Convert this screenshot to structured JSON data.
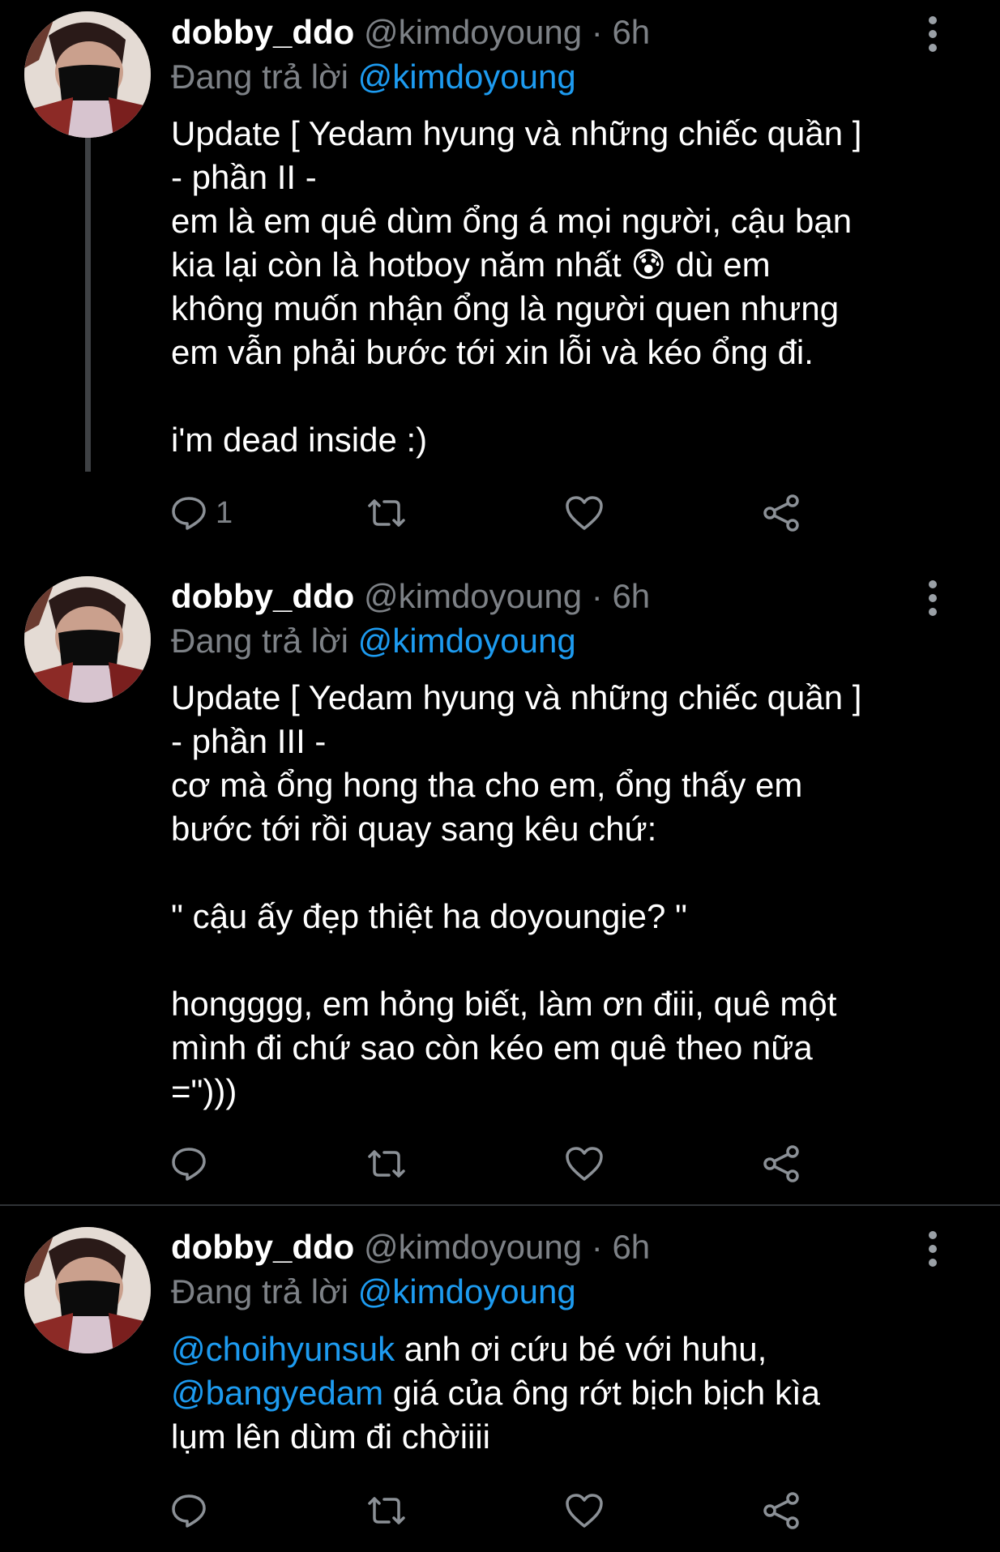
{
  "tweets": [
    {
      "display_name": "dobby_ddo",
      "handle": "@kimdoyoung",
      "separator": "·",
      "time": "6h",
      "reply_prefix": "Đang trả lời",
      "reply_to": "@kimdoyoung",
      "lines": [
        "Update [ Yedam hyung và những chiếc quần ]",
        "- phần II -",
        "em là em quê dùm ổng á mọi người, cậu bạn",
        "kia lại còn là hotboy năm nhất",
        "không muốn nhận ổng là người quen nhưng",
        "em vẫn phải bước tới xin lỗi và kéo ổng đi.",
        "",
        "i'm dead inside :)"
      ],
      "emoji": "😰",
      "line4_tail": "dù em",
      "reply_count": "1"
    },
    {
      "display_name": "dobby_ddo",
      "handle": "@kimdoyoung",
      "separator": "·",
      "time": "6h",
      "reply_prefix": "Đang trả lời",
      "reply_to": "@kimdoyoung",
      "lines": [
        "Update [ Yedam hyung và những chiếc quần ]",
        "- phần III -",
        "cơ mà ổng hong tha cho em, ổng thấy em",
        "bước tới rồi quay sang kêu chứ:",
        "",
        "\" cậu ấy đẹp thiệt ha doyoungie? \"",
        "",
        "hongggg, em hỏng biết, làm ơn điii, quê một",
        "mình đi chứ sao còn kéo em quê theo nữa",
        "=\")))"
      ],
      "reply_count": ""
    },
    {
      "display_name": "dobby_ddo",
      "handle": "@kimdoyoung",
      "separator": "·",
      "time": "6h",
      "reply_prefix": "Đang trả lời",
      "reply_to": "@kimdoyoung",
      "mention1": "@choihyunsuk",
      "line1_rest": " anh ơi cứu bé với huhu,",
      "mention2": "@bangyedam",
      "line2_rest": " giá của ông rớt bịch bịch kìa",
      "line3": "lụm lên dùm đi chờiiii",
      "reply_count": ""
    }
  ],
  "colors": {
    "background": "#000000",
    "text": "#ffffff",
    "secondary": "#7d8186",
    "link": "#1d9bf0",
    "thread_line": "#3e4144"
  },
  "icons": {
    "reply": "reply-bubble-icon",
    "retweet": "retweet-icon",
    "like": "heart-icon",
    "share": "share-icon",
    "more": "more-vertical-icon"
  }
}
